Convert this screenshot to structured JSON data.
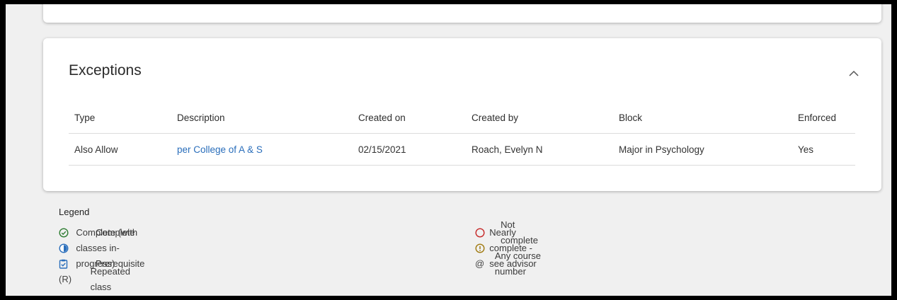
{
  "exceptions": {
    "title": "Exceptions",
    "columns": {
      "type": "Type",
      "description": "Description",
      "created_on": "Created on",
      "created_by": "Created by",
      "block": "Block",
      "enforced": "Enforced"
    },
    "rows": [
      {
        "type": "Also Allow",
        "description": "per College of A & S",
        "created_on": "02/15/2021",
        "created_by": "Roach, Evelyn N",
        "block": "Major in Psychology",
        "enforced": "Yes"
      }
    ]
  },
  "legend": {
    "title": "Legend",
    "items_left": [
      {
        "icon": "check-circle-icon",
        "label": "Complete"
      },
      {
        "icon": "half-circle-icon",
        "label": "Complete (with classes in-progress)"
      },
      {
        "icon": "clipboard-check-icon",
        "label": "Prerequisite"
      },
      {
        "symbol": "(R)",
        "label": "Repeated class"
      }
    ],
    "items_right": [
      {
        "icon": "empty-circle-icon",
        "label": "Not complete"
      },
      {
        "icon": "exclamation-circle-icon",
        "label": "Nearly complete - see advisor"
      },
      {
        "symbol": "@",
        "label": "Any course number"
      }
    ]
  },
  "colors": {
    "link": "#2a6ebb",
    "complete": "#2e7d32",
    "in_progress": "#2a6ebb",
    "not_complete": "#c62828",
    "nearly_complete": "#a07a10"
  }
}
